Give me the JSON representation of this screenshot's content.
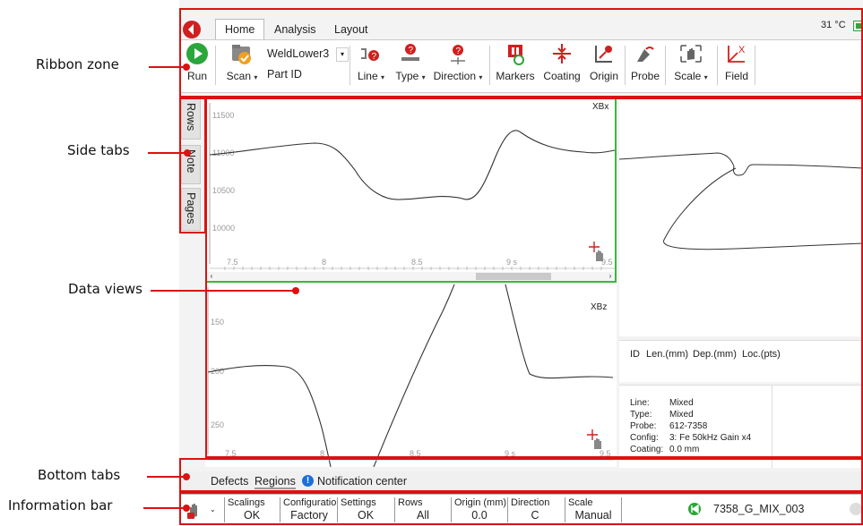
{
  "callouts": {
    "ribbon": "Ribbon zone",
    "side_tabs": "Side tabs",
    "data_views": "Data views",
    "bottom_tabs": "Bottom tabs",
    "info_bar": "Information bar"
  },
  "menu_tabs": [
    "Home",
    "Analysis",
    "Layout"
  ],
  "status": {
    "temperature": "31 °C"
  },
  "ribbon": {
    "run": "Run",
    "scan": "Scan",
    "scan_name": "WeldLower3",
    "part_id": "Part ID",
    "line": "Line",
    "type": "Type",
    "direction": "Direction",
    "markers": "Markers",
    "coating": "Coating",
    "origin": "Origin",
    "probe": "Probe",
    "scale": "Scale",
    "field": "Field"
  },
  "side_tabs": [
    "Rows",
    "Note",
    "Pages"
  ],
  "plots": {
    "top": {
      "label": "XBx",
      "y_ticks": [
        "11500",
        "11000",
        "10500",
        "10000"
      ],
      "x_ticks": [
        "7.5",
        "8",
        "8.5",
        "9 s",
        "9.5"
      ]
    },
    "bottom": {
      "label": "XBz",
      "y_ticks": [
        "150",
        "200",
        "250"
      ],
      "x_ticks": [
        "7.5",
        "8",
        "8.5",
        "9 s",
        "9.5"
      ]
    }
  },
  "defects_header": {
    "id": "ID",
    "len": "Len.(mm)",
    "dep": "Dep.(mm)",
    "loc": "Loc.(pts)"
  },
  "info_panel": [
    {
      "key": "Line:",
      "value": "Mixed"
    },
    {
      "key": "Type:",
      "value": "Mixed"
    },
    {
      "key": "Probe:",
      "value": "612-7358"
    },
    {
      "key": "Config:",
      "value": "3: Fe 50kHz Gain x4"
    },
    {
      "key": "Coating:",
      "value": "0.0 mm"
    }
  ],
  "bottom_tabs": [
    "Defects",
    "Regions",
    "Notification center"
  ],
  "info_bar": {
    "cells": [
      {
        "title": "Scalings",
        "value": "OK"
      },
      {
        "title": "Configuration",
        "value": "Factory"
      },
      {
        "title": "Settings",
        "value": "OK"
      },
      {
        "title": "Rows",
        "value": "All"
      },
      {
        "title": "Origin (mm)",
        "value": "0.0"
      },
      {
        "title": "Direction",
        "value": "C"
      },
      {
        "title": "Scale",
        "value": "Manual"
      }
    ],
    "file_name": "7358_G_MIX_003"
  },
  "colors": {
    "accent_red": "#d11f1f",
    "run_green": "#2aa63a",
    "selection_green": "#3cb83c"
  }
}
